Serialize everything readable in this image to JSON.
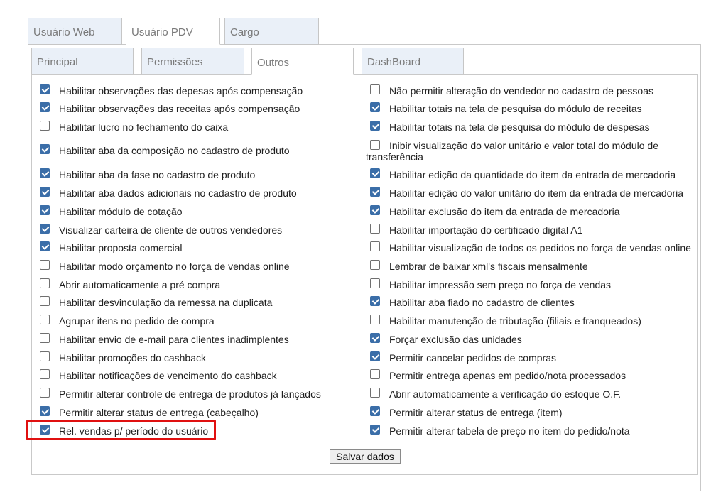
{
  "tabs_top": [
    "Usuário Web",
    "Usuário PDV",
    "Cargo"
  ],
  "tabs_sub": [
    "Principal",
    "Permissões",
    "Outros",
    "DashBoard"
  ],
  "left_items": [
    {
      "label": "Habilitar observações das depesas após compensação",
      "checked": true
    },
    {
      "label": "Habilitar observações das receitas após compensação",
      "checked": true
    },
    {
      "label": "Habilitar lucro no fechamento do caixa",
      "checked": false
    },
    {
      "label": "Habilitar aba da composição no cadastro de produto",
      "checked": true
    },
    {
      "label": "Habilitar aba da fase no cadastro de produto",
      "checked": true
    },
    {
      "label": "Habilitar aba dados adicionais no cadastro de produto",
      "checked": true
    },
    {
      "label": "Habilitar módulo de cotação",
      "checked": true
    },
    {
      "label": "Visualizar carteira de cliente de outros vendedores",
      "checked": true
    },
    {
      "label": "Habilitar proposta comercial",
      "checked": true
    },
    {
      "label": "Habilitar modo orçamento no força de vendas online",
      "checked": false
    },
    {
      "label": "Abrir automaticamente a pré compra",
      "checked": false
    },
    {
      "label": "Habilitar desvinculação da remessa na duplicata",
      "checked": false
    },
    {
      "label": "Agrupar itens no pedido de compra",
      "checked": false
    },
    {
      "label": "Habilitar envio de e-mail para clientes inadimplentes",
      "checked": false
    },
    {
      "label": "Habilitar promoções do cashback",
      "checked": false
    },
    {
      "label": "Habilitar notificações de vencimento do cashback",
      "checked": false
    },
    {
      "label": "Permitir alterar controle de entrega de produtos já lançados",
      "checked": false
    },
    {
      "label": "Permitir alterar status de entrega (cabeçalho)",
      "checked": true
    },
    {
      "label": "Rel. vendas p/ período do usuário",
      "checked": true
    }
  ],
  "right_items": [
    {
      "label": "Não permitir alteração do vendedor no cadastro de pessoas",
      "checked": false
    },
    {
      "label": "Habilitar totais na tela de pesquisa do módulo de receitas",
      "checked": true
    },
    {
      "label": "Habilitar totais na tela de pesquisa do módulo de despesas",
      "checked": true
    },
    {
      "label": "Inibir visualização do valor unitário e valor total do módulo de transferência",
      "checked": false
    },
    {
      "label": "Habilitar edição da quantidade do item da entrada de mercadoria",
      "checked": true
    },
    {
      "label": "Habilitar edição do valor unitário do item da entrada de mercadoria",
      "checked": true
    },
    {
      "label": "Habilitar exclusão do item da entrada de mercadoria",
      "checked": true
    },
    {
      "label": "Habilitar importação do certificado digital A1",
      "checked": false
    },
    {
      "label": "Habilitar visualização de todos os pedidos no força de vendas online",
      "checked": false
    },
    {
      "label": "Lembrar de baixar xml's fiscais mensalmente",
      "checked": false
    },
    {
      "label": "Habilitar impressão sem preço no força de vendas",
      "checked": false
    },
    {
      "label": "Habilitar aba fiado no cadastro de clientes",
      "checked": true
    },
    {
      "label": "Habilitar manutenção de tributação (filiais e franqueados)",
      "checked": false
    },
    {
      "label": "Forçar exclusão das unidades",
      "checked": true
    },
    {
      "label": "Permitir cancelar pedidos de compras",
      "checked": true
    },
    {
      "label": "Permitir entrega apenas em pedido/nota processados",
      "checked": false
    },
    {
      "label": "Abrir automaticamente a verificação do estoque O.F.",
      "checked": false
    },
    {
      "label": "Permitir alterar status de entrega (item)",
      "checked": true
    },
    {
      "label": "Permitir alterar tabela de preço no item do pedido/nota",
      "checked": true
    }
  ],
  "save_label": "Salvar dados"
}
